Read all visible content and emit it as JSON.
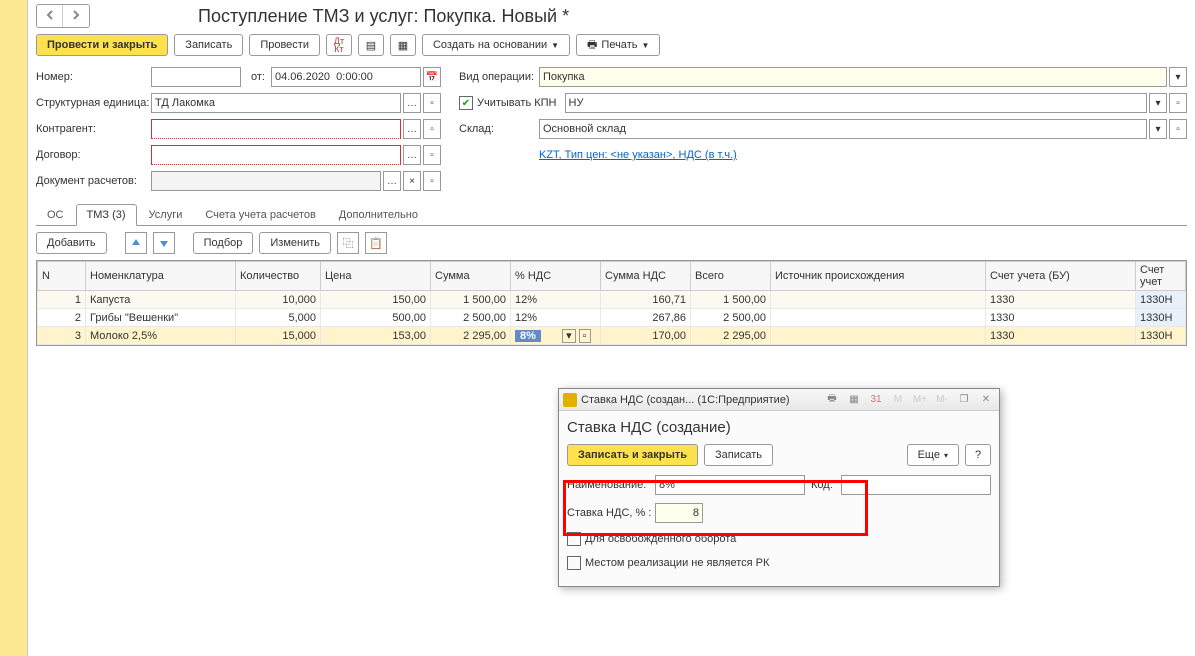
{
  "title": "Поступление ТМЗ и услуг: Покупка. Новый *",
  "toolbar": {
    "commit": "Провести и закрыть",
    "save": "Записать",
    "post": "Провести",
    "create_base": "Создать на основании",
    "print": "Печать"
  },
  "form": {
    "number_lbl": "Номер:",
    "from_lbl": "от:",
    "date": "04.06.2020  0:00:00",
    "org_lbl": "Структурная единица:",
    "org": "ТД Лакомка",
    "counter_lbl": "Контрагент:",
    "contract_lbl": "Договор:",
    "docset_lbl": "Документ расчетов:",
    "optype_lbl": "Вид операции:",
    "optype": "Покупка",
    "kpn_lbl": "Учитывать КПН",
    "kpn_val": "НУ",
    "sklad_lbl": "Склад:",
    "sklad": "Основной склад",
    "info": "KZT, Тип цен: <не указан>, НДС (в т.ч.)"
  },
  "tabs": {
    "os": "ОС",
    "tmz": "ТМЗ (3)",
    "serv": "Услуги",
    "accts": "Счета учета расчетов",
    "extra": "Дополнительно"
  },
  "subbar": {
    "add": "Добавить",
    "pick": "Подбор",
    "edit": "Изменить"
  },
  "cols": {
    "n": "N",
    "nom": "Номенклатура",
    "qty": "Количество",
    "price": "Цена",
    "sum": "Сумма",
    "nds": "% НДС",
    "sumnds": "Сумма НДС",
    "total": "Всего",
    "src": "Источник происхождения",
    "acc": "Счет учета (БУ)",
    "acc2": "Счет учет"
  },
  "rows": [
    {
      "n": "1",
      "nom": "Капуста",
      "qty": "10,000",
      "price": "150,00",
      "sum": "1 500,00",
      "nds": "12%",
      "sumnds": "160,71",
      "total": "1 500,00",
      "acc": "1330",
      "acc2": "1330Н"
    },
    {
      "n": "2",
      "nom": "Грибы \"Вешенки\"",
      "qty": "5,000",
      "price": "500,00",
      "sum": "2 500,00",
      "nds": "12%",
      "sumnds": "267,86",
      "total": "2 500,00",
      "acc": "1330",
      "acc2": "1330Н"
    },
    {
      "n": "3",
      "nom": "Молоко 2,5%",
      "qty": "15,000",
      "price": "153,00",
      "sum": "2 295,00",
      "nds": "8%",
      "sumnds": "170,00",
      "total": "2 295,00",
      "acc": "1330",
      "acc2": "1330Н"
    }
  ],
  "dialog": {
    "wintitle": "Ставка НДС (создан...   (1С:Предприятие)",
    "header": "Ставка НДС (создание)",
    "save_close": "Записать и закрыть",
    "save": "Записать",
    "more": "Еще",
    "name_lbl": "Наименование:",
    "name_val": "8%",
    "rate_lbl": "Ставка НДС, % :",
    "rate_val": "8",
    "code_lbl": "Код:",
    "cb1": "Для освобожденного оборота",
    "cb2": "Местом реализации не является РК"
  }
}
